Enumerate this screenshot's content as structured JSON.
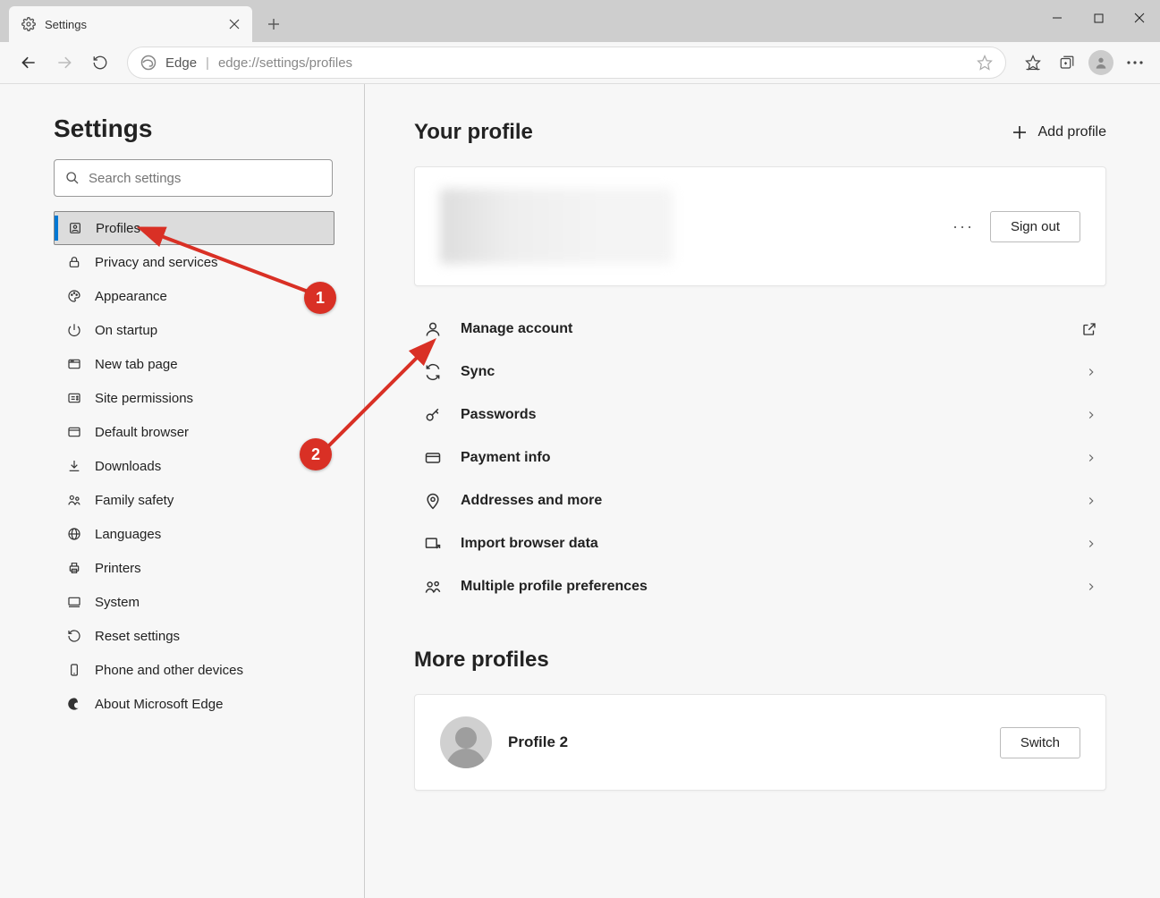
{
  "tab": {
    "title": "Settings"
  },
  "addressbar": {
    "source": "Edge",
    "url": "edge://settings/profiles"
  },
  "sidebar": {
    "title": "Settings",
    "search_placeholder": "Search settings",
    "items": [
      {
        "label": "Profiles",
        "selected": true,
        "icon": "profile"
      },
      {
        "label": "Privacy and services",
        "selected": false,
        "icon": "lock"
      },
      {
        "label": "Appearance",
        "selected": false,
        "icon": "palette"
      },
      {
        "label": "On startup",
        "selected": false,
        "icon": "power"
      },
      {
        "label": "New tab page",
        "selected": false,
        "icon": "newtab"
      },
      {
        "label": "Site permissions",
        "selected": false,
        "icon": "permissions"
      },
      {
        "label": "Default browser",
        "selected": false,
        "icon": "browser"
      },
      {
        "label": "Downloads",
        "selected": false,
        "icon": "download"
      },
      {
        "label": "Family safety",
        "selected": false,
        "icon": "family"
      },
      {
        "label": "Languages",
        "selected": false,
        "icon": "globe"
      },
      {
        "label": "Printers",
        "selected": false,
        "icon": "printer"
      },
      {
        "label": "System",
        "selected": false,
        "icon": "system"
      },
      {
        "label": "Reset settings",
        "selected": false,
        "icon": "reset"
      },
      {
        "label": "Phone and other devices",
        "selected": false,
        "icon": "phone"
      },
      {
        "label": "About Microsoft Edge",
        "selected": false,
        "icon": "edge"
      }
    ]
  },
  "main": {
    "heading": "Your profile",
    "add_profile": "Add profile",
    "sign_out": "Sign out",
    "items": [
      {
        "label": "Manage account",
        "icon": "person",
        "action": "external"
      },
      {
        "label": "Sync",
        "icon": "sync",
        "action": "chevron"
      },
      {
        "label": "Passwords",
        "icon": "key",
        "action": "chevron"
      },
      {
        "label": "Payment info",
        "icon": "card",
        "action": "chevron"
      },
      {
        "label": "Addresses and more",
        "icon": "pin",
        "action": "chevron"
      },
      {
        "label": "Import browser data",
        "icon": "import",
        "action": "chevron"
      },
      {
        "label": "Multiple profile preferences",
        "icon": "multiprofile",
        "action": "chevron"
      }
    ],
    "more_heading": "More profiles",
    "more_profile_name": "Profile 2",
    "switch": "Switch"
  },
  "annotations": {
    "m1": "1",
    "m2": "2"
  }
}
